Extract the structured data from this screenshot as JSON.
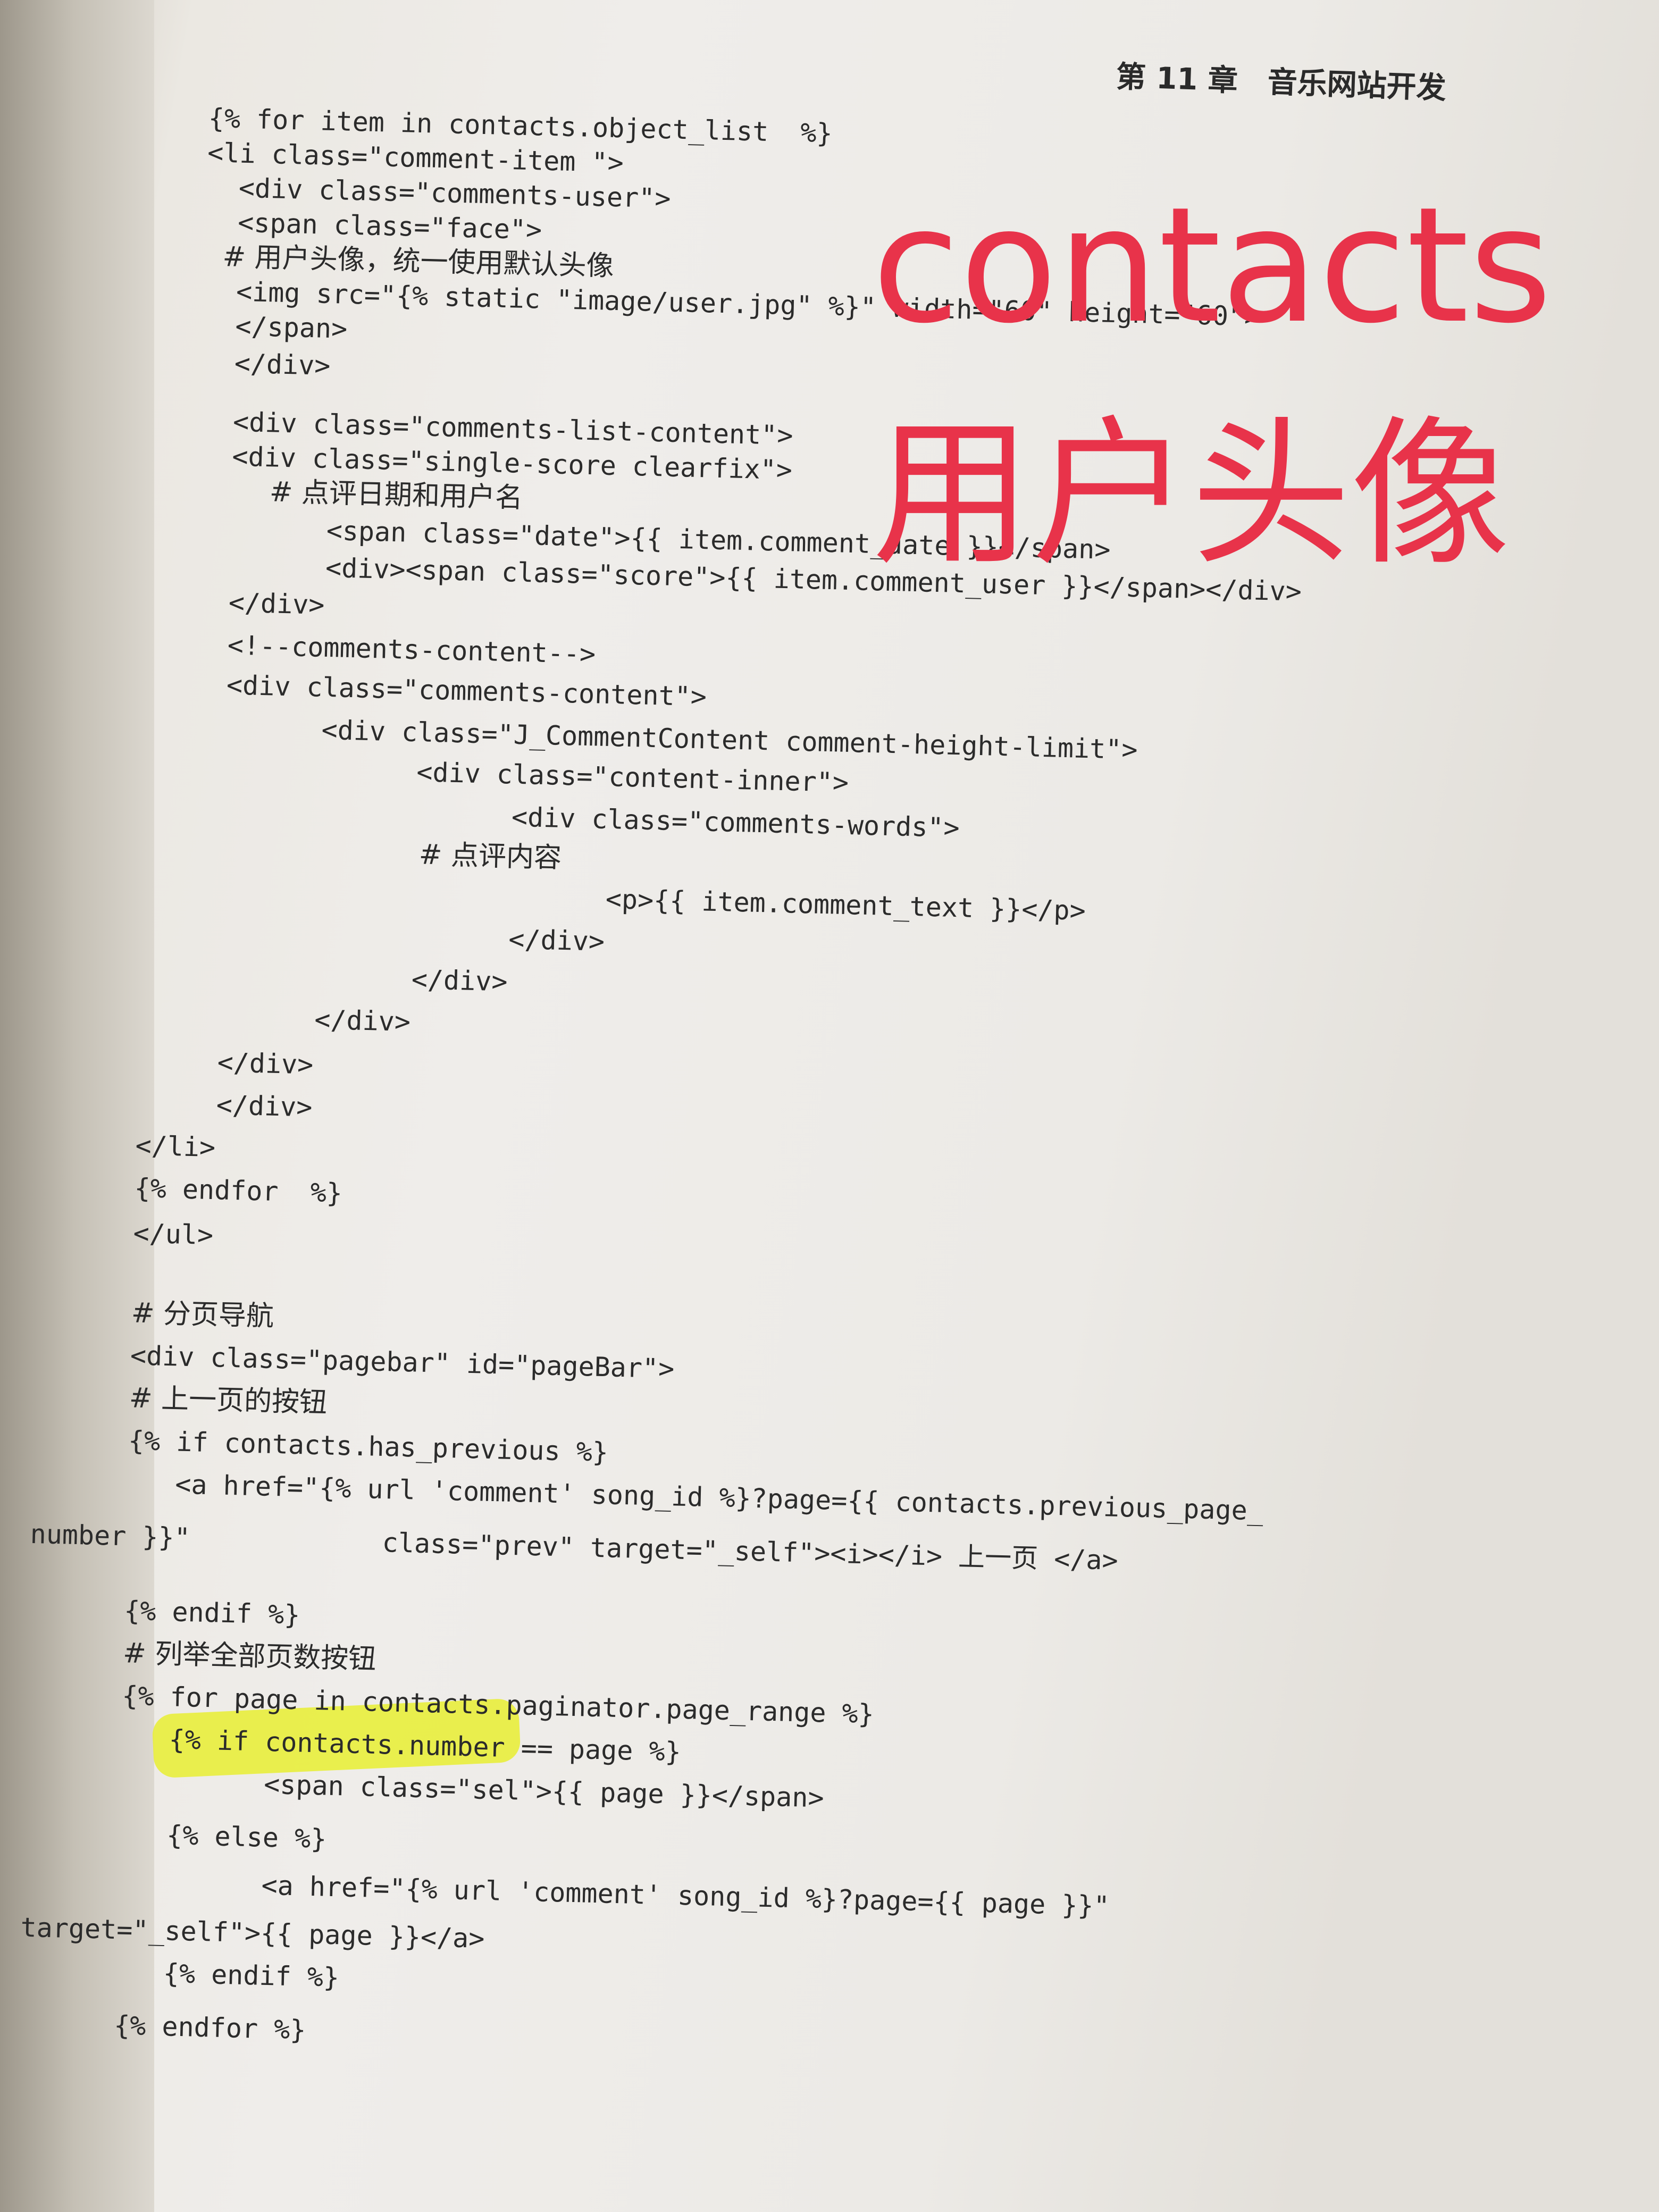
{
  "header": {
    "chapter": "第 11 章　音乐网站开发"
  },
  "overlay": {
    "line1": "contacts",
    "line2": "用户头像"
  },
  "code_lines": [
    "{% for item in contacts.object_list  %}",
    "<li class=\"comment-item \">",
    "  <div class=\"comments-user\">",
    "  <span class=\"face\">",
    "  # 用户头像，统一使用默认头像",
    "  <img src=\"{% static \"image/user.jpg\" %}\" width=\"60\" height=\"60\">",
    "  </span>",
    "  </div>",
    "  <div class=\"comments-list-content\">",
    "  <div class=\"single-score clearfix\">",
    "        # 点评日期和用户名",
    "        <span class=\"date\">{{ item.comment_date }}</span>",
    "        <div><span class=\"score\">{{ item.comment_user }}</span></div>",
    "  </div>",
    "  <!--comments-content-->",
    "  <div class=\"comments-content\">",
    "        <div class=\"J_CommentContent comment-height-limit\">",
    "              <div class=\"content-inner\">",
    "                    <div class=\"comments-words\">",
    "                          # 点评内容",
    "                          <p>{{ item.comment_text }}</p>",
    "                    </div>",
    "              </div>",
    "        </div>",
    "  </div>",
    "  </div>",
    "</li>",
    "{% endfor  %}",
    "</ul>",
    "# 分页导航",
    "<div class=\"pagebar\" id=\"pageBar\">",
    "# 上一页的按钮",
    "{% if contacts.has_previous %}",
    "   <a href=\"{% url 'comment' song_id %}?page={{ contacts.previous_page_",
    "number }}\"            class=\"prev\" target=\"_self\"><i></i> 上一页 </a>",
    "{% endif %}",
    "# 列举全部页数按钮",
    "{% for page in contacts.paginator.page_range %}",
    "   {% if contacts.number == page %}",
    "         <span class=\"sel\">{{ page }}</span>",
    "   {% else %}",
    "         <a href=\"{% url 'comment' song_id %}?page={{ page }}\"",
    "target=\"_self\">{{ page }}</a>",
    "   {% endif %}",
    "{% endfor %}"
  ]
}
